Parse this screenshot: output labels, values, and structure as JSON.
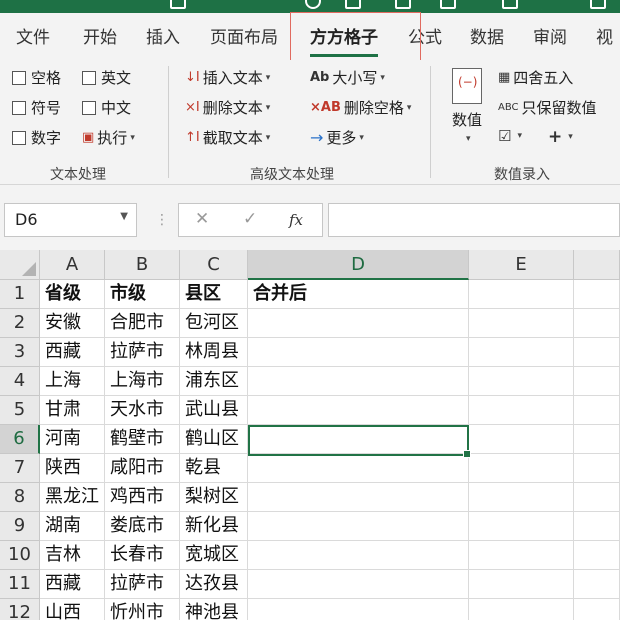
{
  "tabs": [
    {
      "label": "文件"
    },
    {
      "label": "开始"
    },
    {
      "label": "插入"
    },
    {
      "label": "页面布局"
    },
    {
      "label": "方方格子"
    },
    {
      "label": "公式"
    },
    {
      "label": "数据"
    },
    {
      "label": "审阅"
    },
    {
      "label": "视"
    }
  ],
  "active_tab": "方方格子",
  "ribbon": {
    "text_group": {
      "label": "文本处理",
      "checkboxes": [
        "空格",
        "英文",
        "符号",
        "中文",
        "数字"
      ],
      "execute_label": "执行"
    },
    "advanced_group": {
      "label": "高级文本处理",
      "buttons": [
        "插入文本",
        "删除文本",
        "截取文本",
        "大小写",
        "删除空格",
        "更多"
      ]
    },
    "number_group": {
      "label": "数值录入",
      "big_button": "数值",
      "buttons": [
        "四舍五入",
        "只保留数值"
      ],
      "small_icon_text": "ABC"
    }
  },
  "formula_bar": {
    "name_box": "D6",
    "cancel_glyph": "✕",
    "confirm_glyph": "✓",
    "fx_label": "fx",
    "value": ""
  },
  "grid": {
    "columns": [
      "A",
      "B",
      "C",
      "D",
      "E"
    ],
    "rows": [
      {
        "num": "1",
        "cells": [
          "省级",
          "市级",
          "县区",
          "合并后"
        ]
      },
      {
        "num": "2",
        "cells": [
          "安徽",
          "合肥市",
          "包河区",
          ""
        ]
      },
      {
        "num": "3",
        "cells": [
          "西藏",
          "拉萨市",
          "林周县",
          ""
        ]
      },
      {
        "num": "4",
        "cells": [
          "上海",
          "上海市",
          "浦东区",
          ""
        ]
      },
      {
        "num": "5",
        "cells": [
          "甘肃",
          "天水市",
          "武山县",
          ""
        ]
      },
      {
        "num": "6",
        "cells": [
          "河南",
          "鹤壁市",
          "鹤山区",
          ""
        ]
      },
      {
        "num": "7",
        "cells": [
          "陕西",
          "咸阳市",
          "乾县",
          ""
        ]
      },
      {
        "num": "8",
        "cells": [
          "黑龙江",
          "鸡西市",
          "梨树区",
          ""
        ]
      },
      {
        "num": "9",
        "cells": [
          "湖南",
          "娄底市",
          "新化县",
          ""
        ]
      },
      {
        "num": "10",
        "cells": [
          "吉林",
          "长春市",
          "宽城区",
          ""
        ]
      },
      {
        "num": "11",
        "cells": [
          "西藏",
          "拉萨市",
          "达孜县",
          ""
        ]
      },
      {
        "num": "12",
        "cells": [
          "山西",
          "忻州市",
          "神池县",
          ""
        ]
      }
    ],
    "selected_cell": "D6"
  },
  "colors": {
    "excel_green": "#217346",
    "tab_highlight": "#e06a5f"
  }
}
